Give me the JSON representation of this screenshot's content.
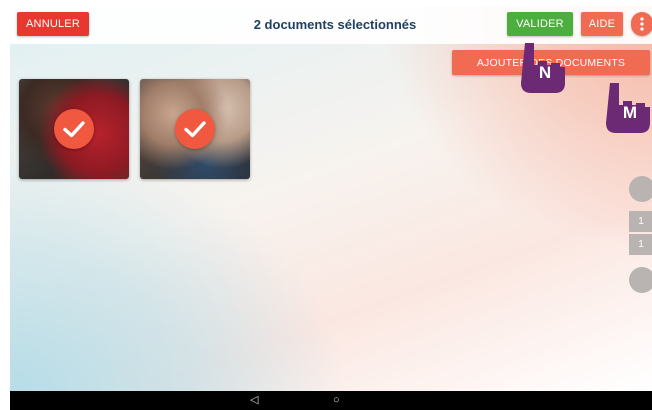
{
  "header": {
    "cancel_label": "ANNULER",
    "title": "2 documents sélectionnés",
    "validate_label": "VALIDER",
    "help_label": "AIDE",
    "more_icon": "more-vertical-icon"
  },
  "toolbar": {
    "add_documents_label": "AJOUTER DES DOCUMENTS"
  },
  "documents": [
    {
      "selected": true,
      "icon": "checkmark-icon"
    },
    {
      "selected": true,
      "icon": "checkmark-icon"
    }
  ],
  "sidebar": {
    "page_numbers": [
      "1",
      "1"
    ]
  },
  "annotations": {
    "hand_n_label": "N",
    "hand_m_label": "M"
  },
  "nav": {
    "back_glyph": "◁",
    "home_glyph": "○"
  },
  "colors": {
    "cancel": "#e8372f",
    "validate": "#4cae3e",
    "accent": "#f06b52",
    "title": "#1f3f63",
    "hand": "#6b2a73"
  }
}
